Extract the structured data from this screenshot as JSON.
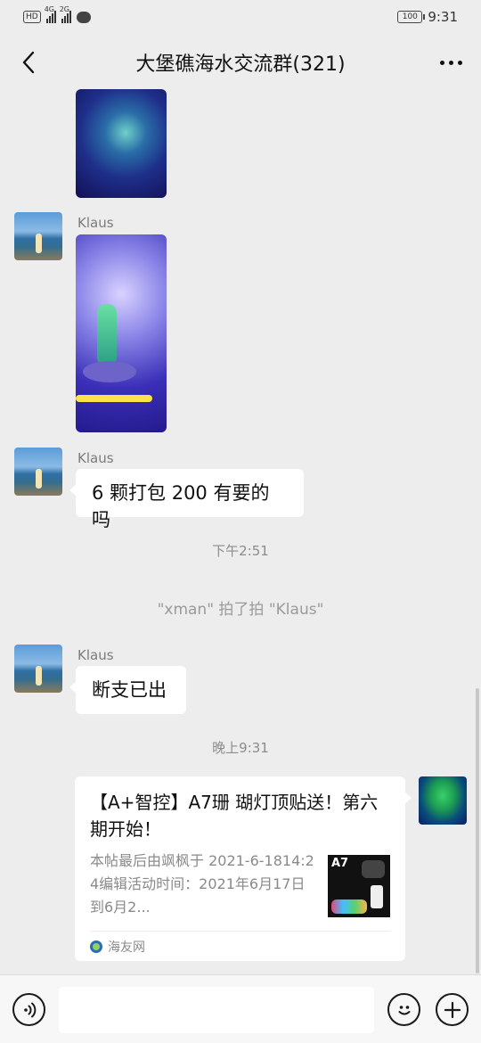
{
  "status_bar": {
    "hd": "HD",
    "net1": "4G",
    "net2": "2G",
    "battery": "100",
    "time": "9:31"
  },
  "header": {
    "title": "大堡礁海水交流群(321)"
  },
  "messages": {
    "sender1": "Klaus",
    "sender2": "Klaus",
    "text2": "6 颗打包 200 有要的吗",
    "time1": "下午2:51",
    "system1": "\"xman\" 拍了拍 \"Klaus\"",
    "sender3": "Klaus",
    "text3": "断支已出",
    "time2": "晚上9:31"
  },
  "link_card": {
    "title": "【A+智控】A7珊 瑚灯顶贴送！第六期开始！",
    "desc": "本帖最后由飒枫于 2021-6-1814:24编辑活动时间：2021年6月17日到6月2...",
    "thumb_label": "A7",
    "source": "海友网"
  },
  "input_bar": {
    "placeholder": ""
  },
  "icons": [
    "back-icon",
    "more-icon",
    "voice-icon",
    "emoji-icon",
    "plus-icon"
  ]
}
